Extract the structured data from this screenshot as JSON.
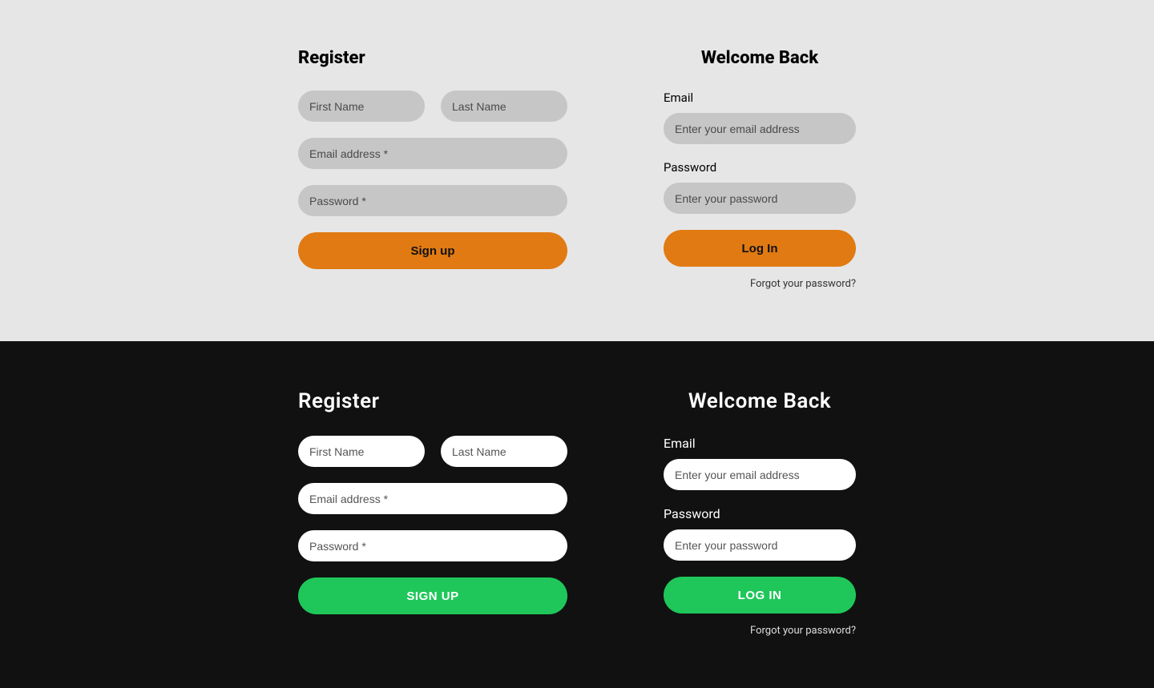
{
  "light": {
    "register": {
      "title": "Register",
      "first_name_ph": "First Name",
      "last_name_ph": "Last Name",
      "email_ph": "Email address *",
      "password_ph": "Password *",
      "submit": "Sign up"
    },
    "login": {
      "title": "Welcome Back",
      "email_label": "Email",
      "email_ph": "Enter your email address",
      "password_label": "Password",
      "password_ph": "Enter your password",
      "submit": "Log In",
      "forgot": "Forgot your password?"
    }
  },
  "dark": {
    "register": {
      "title": "Register",
      "first_name_ph": "First Name",
      "last_name_ph": "Last Name",
      "email_ph": "Email address *",
      "password_ph": "Password *",
      "submit": "SIGN UP"
    },
    "login": {
      "title": "Welcome Back",
      "email_label": "Email",
      "email_ph": "Enter your email address",
      "password_label": "Password",
      "password_ph": "Enter your password",
      "submit": "LOG IN",
      "forgot": "Forgot your password?"
    }
  }
}
